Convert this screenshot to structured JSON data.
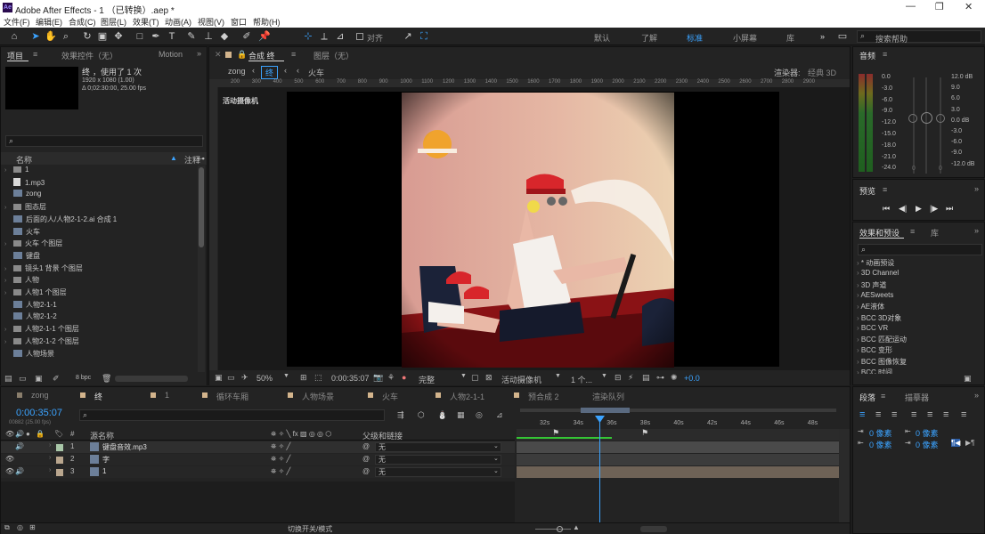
{
  "app": {
    "title": "Adobe After Effects - 1 （已转换）.aep *",
    "logo": "Ae"
  },
  "menu": [
    "文件(F)",
    "编辑(E)",
    "合成(C)",
    "图层(L)",
    "效果(T)",
    "动画(A)",
    "视图(V)",
    "窗口",
    "帮助(H)"
  ],
  "toolbar": {
    "align_label": "对齐",
    "workspaces": [
      "默认",
      "了解",
      "标准",
      "小屏幕",
      "库"
    ],
    "active_workspace": "标准",
    "search_placeholder": "搜索帮助"
  },
  "project": {
    "tab_project": "项目",
    "tab_effects": "效果控件（无）",
    "tab_motion": "Motion",
    "selected_name": "终",
    "selected_usage": "，使用了 1 次",
    "selected_info1": "1920 x 1080 (1.00)",
    "selected_info2": "Δ 0;02:30:00, 25.00 fps",
    "col_name": "名称",
    "col_comment": "注释",
    "bpc": "8 bpc",
    "items": [
      {
        "name": "1",
        "type": "folder"
      },
      {
        "name": "1.mp3",
        "type": "file"
      },
      {
        "name": "zong",
        "type": "comp"
      },
      {
        "name": "图态层",
        "type": "folder"
      },
      {
        "name": "后面的人/人物2-1-2.ai 合成 1",
        "type": "comp"
      },
      {
        "name": "火车",
        "type": "comp"
      },
      {
        "name": "火车 个图层",
        "type": "folder"
      },
      {
        "name": "键盘",
        "type": "comp"
      },
      {
        "name": "镜头1   背景 个图层",
        "type": "folder"
      },
      {
        "name": "人物",
        "type": "folder"
      },
      {
        "name": "人物1 个图层",
        "type": "folder"
      },
      {
        "name": "人物2-1-1",
        "type": "comp"
      },
      {
        "name": "人物2-1-2",
        "type": "comp"
      },
      {
        "name": "人物2-1-1 个图层",
        "type": "folder"
      },
      {
        "name": "人物2-1-2 个图层",
        "type": "folder"
      },
      {
        "name": "人物场景",
        "type": "comp"
      }
    ]
  },
  "viewer": {
    "tab_comp": "合成 终",
    "tab_layer": "图层（无）",
    "crumbs": [
      "zong",
      "终",
      "火车"
    ],
    "renderer_label": "渲染器:",
    "renderer_value": "经典 3D",
    "camera_label": "活动摄像机",
    "ruler_ticks": [
      "200",
      "300",
      "400",
      "500",
      "600",
      "700",
      "800",
      "900",
      "1000",
      "1100",
      "1200",
      "1300",
      "1400",
      "1500",
      "1600",
      "1700",
      "1800",
      "1900",
      "2000",
      "2100",
      "2200",
      "2300",
      "2400",
      "2500",
      "2600",
      "2700",
      "2800",
      "2900"
    ],
    "zoom": "50%",
    "timecode": "0:00:35:07",
    "resolution": "完整",
    "view": "活动摄像机",
    "views": "1 个...",
    "exposure": "+0.0"
  },
  "audio": {
    "tab": "音频",
    "left_scale": [
      "0.0",
      "-3.0",
      "-6.0",
      "-9.0",
      "-12.0",
      "-15.0",
      "-18.0",
      "-21.0",
      "-24.0"
    ],
    "right_scale": [
      "12.0 dB",
      "9.0",
      "6.0",
      "3.0",
      "0.0 dB",
      "-3.0",
      "-6.0",
      "-9.0",
      "-12.0 dB"
    ],
    "zero": "0"
  },
  "preview": {
    "tab": "预览"
  },
  "effects": {
    "tab": "效果和预设",
    "tab_lib": "库",
    "items": [
      "* 动画预设",
      "3D Channel",
      "3D 声道",
      "AESweets",
      "AE液体",
      "BCC 3D对象",
      "BCC VR",
      "BCC 匹配运动",
      "BCC 变形",
      "BCC 图像恢复",
      "BCC 时间"
    ]
  },
  "paragraph": {
    "tab": "段落",
    "tab2": "描摹器",
    "indent": [
      "0 像素",
      "0 像素",
      "0 像素",
      "0 像素",
      "0 像素"
    ]
  },
  "timeline": {
    "tabs": [
      "zong",
      "终",
      "1",
      "循环车厢",
      "人物场景",
      "火车",
      "人物2-1-1",
      "预合成 2",
      "渲染队列"
    ],
    "active_tab": "终",
    "timecode": "0:00:35:07",
    "fps": "00882 (25.00 fps)",
    "col_source": "源名称",
    "col_parent": "父级和链接",
    "layers": [
      {
        "num": "1",
        "name": "键盘音效.mp3",
        "parent": "无",
        "color": "#a9c7a8"
      },
      {
        "num": "2",
        "name": "字",
        "parent": "无",
        "color": "#b9a68e"
      },
      {
        "num": "3",
        "name": "1",
        "parent": "无",
        "color": "#b9a68e"
      }
    ],
    "ruler": [
      "32s",
      "34s",
      "36s",
      "38s",
      "40s",
      "42s",
      "44s",
      "46s",
      "48s"
    ],
    "footer": "切换开关/模式"
  },
  "colors": {
    "accent": "#3ba3ff",
    "bg": "#1d1d1d",
    "panel": "#232323",
    "marker_green": "#35c435"
  }
}
